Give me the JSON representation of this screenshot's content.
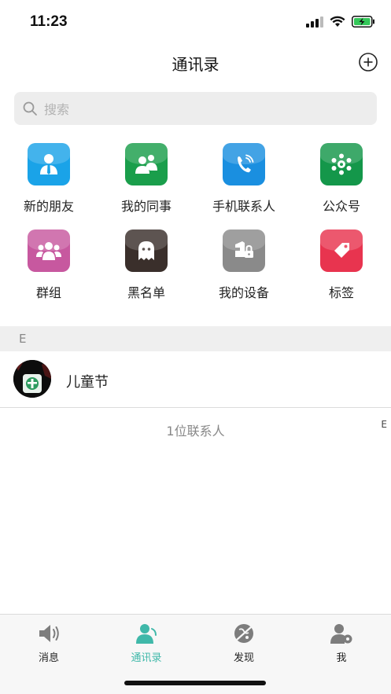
{
  "status_bar": {
    "time": "11:23"
  },
  "header": {
    "title": "通讯录"
  },
  "search": {
    "placeholder": "搜索"
  },
  "shortcuts": [
    {
      "label": "新的朋友",
      "icon": "new-friends-icon",
      "color": "#1aa3e8"
    },
    {
      "label": "我的同事",
      "icon": "colleagues-icon",
      "color": "#1a9e4b"
    },
    {
      "label": "手机联系人",
      "icon": "phone-contacts-icon",
      "color": "#1a8fe0"
    },
    {
      "label": "公众号",
      "icon": "official-accounts-icon",
      "color": "#14974a"
    },
    {
      "label": "群组",
      "icon": "groups-icon",
      "color": "#c7589f"
    },
    {
      "label": "黑名单",
      "icon": "ghost-icon",
      "color": "#3a2f2b"
    },
    {
      "label": "我的设备",
      "icon": "device-lock-icon",
      "color": "#8a8a8a"
    },
    {
      "label": "标签",
      "icon": "tag-icon",
      "color": "#e8344f"
    }
  ],
  "contacts": {
    "section_letter": "E",
    "items": [
      {
        "name": "儿童节"
      }
    ],
    "count_text": "1位联系人",
    "index_letter": "E"
  },
  "tab_bar": {
    "accent": "#3fb8a9",
    "tabs": [
      {
        "label": "消息",
        "icon": "speaker-icon",
        "active": false
      },
      {
        "label": "通讯录",
        "icon": "contacts-icon",
        "active": true
      },
      {
        "label": "发现",
        "icon": "discover-icon",
        "active": false
      },
      {
        "label": "我",
        "icon": "profile-settings-icon",
        "active": false
      }
    ]
  }
}
